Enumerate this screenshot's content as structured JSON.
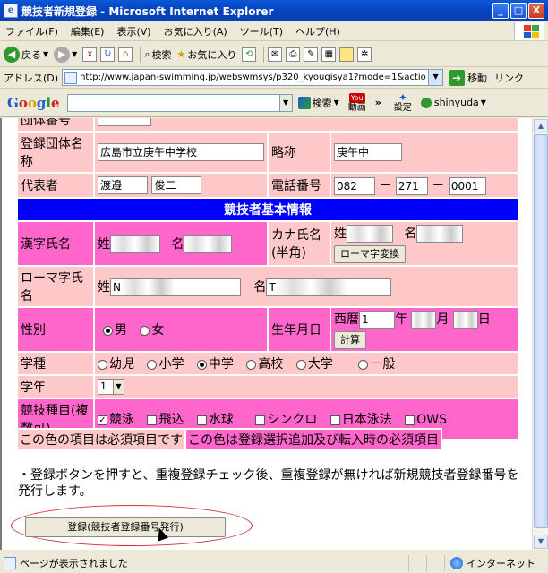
{
  "window": {
    "title": "競技者新規登録 - Microsoft Internet Explorer",
    "btn_min": "_",
    "btn_max": "□",
    "btn_close": "X"
  },
  "menu": [
    "ファイル(F)",
    "編集(E)",
    "表示(V)",
    "お気に入り(A)",
    "ツール(T)",
    "ヘルプ(H)"
  ],
  "toolbar": {
    "back": "戻る",
    "search": "検索",
    "favorites": "お気に入り"
  },
  "address": {
    "label": "アドレス(D)",
    "url": "http://www.japan-swimming.jp/webswmsys/p320_kyougisya1?mode=1&actio",
    "go": "移動",
    "links": "リンク"
  },
  "google": {
    "logo": [
      "G",
      "o",
      "o",
      "g",
      "l",
      "e"
    ],
    "search": "検索",
    "video": "動画",
    "settings": "設定",
    "user": "shinyuda",
    "more": "»"
  },
  "form": {
    "cut_label": "団体番号",
    "team_label": "登録団体名称",
    "team_value": "広島市立庚午中学校",
    "abbr_label": "略称",
    "abbr_value": "庚午中",
    "rep_label": "代表者",
    "rep_last": "渡邉",
    "rep_first": "俊二",
    "phone_label": "電話番号",
    "phone1": "082",
    "phone2": "271",
    "phone3": "0001",
    "phone_sep": "－",
    "section_title": "競技者基本情報",
    "kanji_label": "漢字氏名",
    "sei": "姓",
    "mei": "名",
    "kanji_last": "我",
    "kanji_first": "達",
    "kana_label": "カナ氏名(半角)",
    "romaji_btn": "ローマ字変換",
    "roman_label": "ローマ字氏名",
    "roman_last": "N",
    "roman_first": "T",
    "gender_label": "性別",
    "male": "男",
    "female": "女",
    "birth_label": "生年月日",
    "seireki": "西暦",
    "birth_year": "1",
    "year": "年",
    "month": "月",
    "day": "日",
    "calc_btn": "計算",
    "school_label": "学種",
    "school_opts": [
      "幼児",
      "小学",
      "中学",
      "高校",
      "大学",
      "一般"
    ],
    "grade_label": "学年",
    "grade_value": "1",
    "event_label": "競技種目(複数可)",
    "event_opts": [
      "競泳",
      "飛込",
      "水球",
      "シンクロ",
      "日本泳法",
      "OWS"
    ]
  },
  "legend": {
    "required": "この色の項目は必須項目です",
    "required_add": "この色は登録選択追加及び転入時の必須項目"
  },
  "note": "・登録ボタンを押すと、重複登録チェック後、重複登録が無ければ新規競技者登録番号を発行します。",
  "submit": "登録(競技者登録番号発行)",
  "status": {
    "text": "ページが表示されました",
    "zone": "インターネット"
  },
  "colors": {
    "required": "#ffc8c8",
    "required_add": "#ff66cc",
    "header": "#0000ff"
  }
}
